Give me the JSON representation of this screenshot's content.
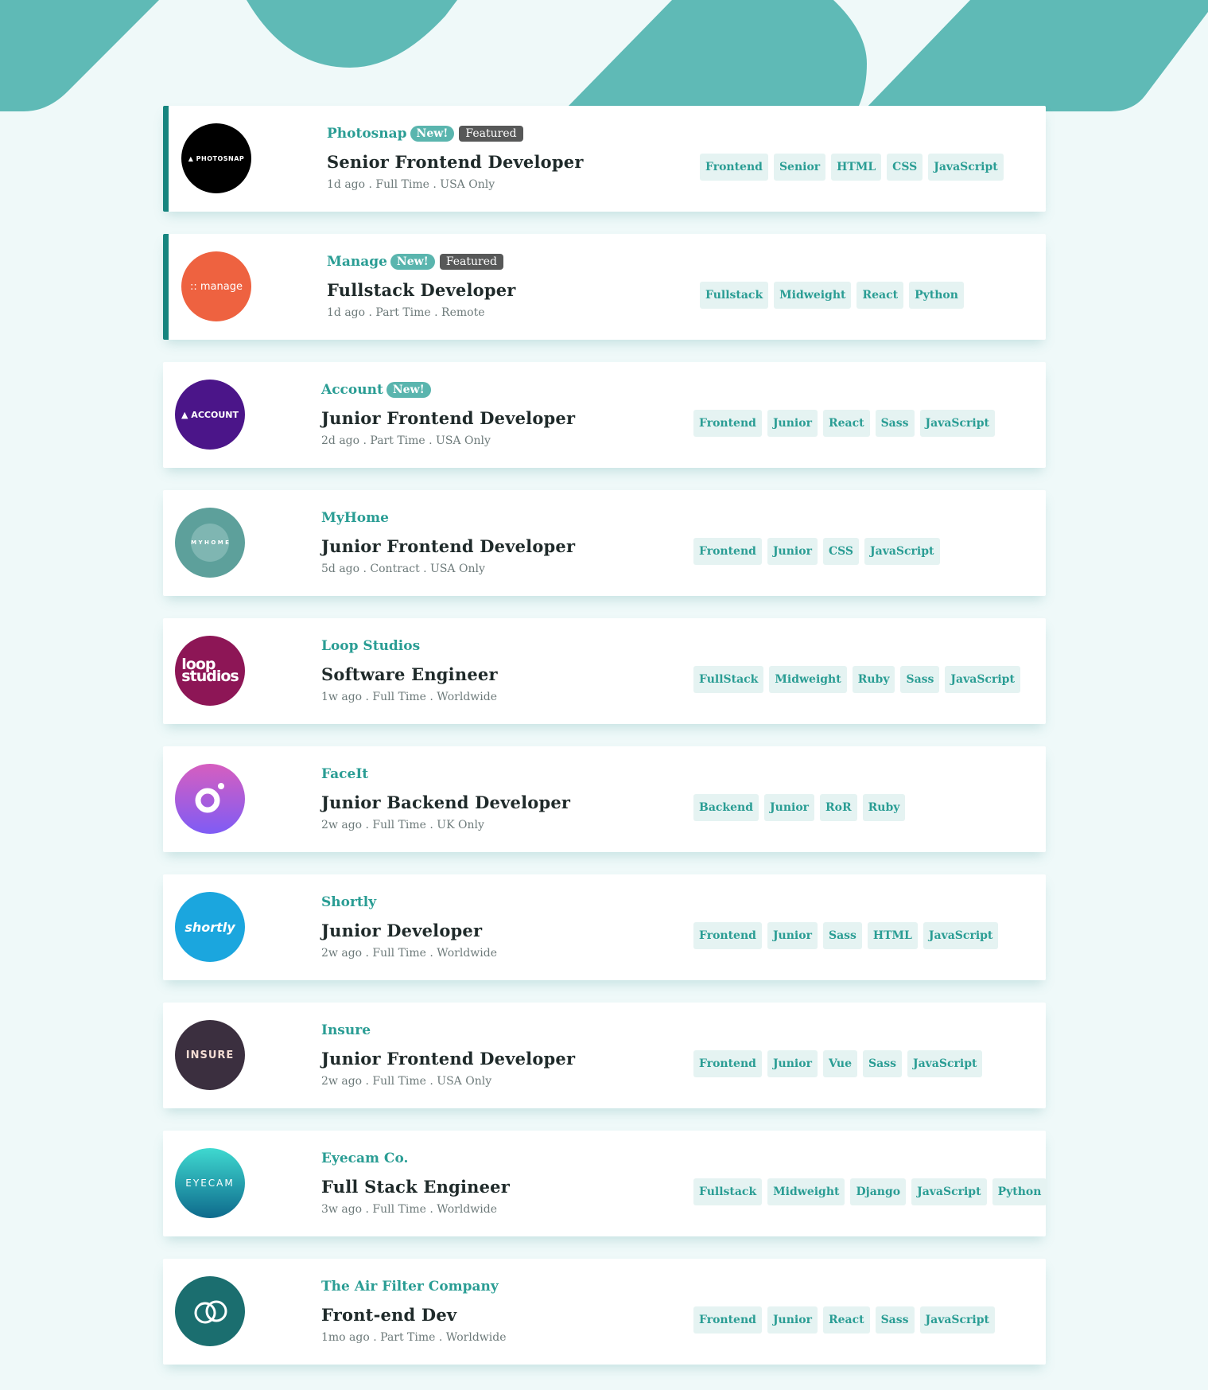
{
  "colors": {
    "primary": "#5ab5ae",
    "dark_cyan": "#16857f",
    "background": "#eff9f9",
    "tag_bg": "#e5f3f2"
  },
  "jobs": [
    {
      "company": "Photosnap",
      "new": "New!",
      "featured": "Featured",
      "position": "Senior Frontend Developer",
      "meta": "1d ago . Full Time . USA Only",
      "logo_text": "PHOTOSNAP",
      "logo_color": "#000000",
      "tags": [
        "Frontend",
        "Senior",
        "HTML",
        "CSS",
        "JavaScript"
      ]
    },
    {
      "company": "Manage",
      "new": "New!",
      "featured": "Featured",
      "position": "Fullstack Developer",
      "meta": "1d ago . Part Time . Remote",
      "logo_text": ":: manage",
      "logo_color": "#ee6240",
      "tags": [
        "Fullstack",
        "Midweight",
        "React",
        "Python"
      ]
    },
    {
      "company": "Account",
      "new": "New!",
      "position": "Junior Frontend Developer",
      "meta": "2d ago . Part Time . USA Only",
      "logo_text": "ACCOUNT",
      "logo_color": "#4b1589",
      "tags": [
        "Frontend",
        "Junior",
        "React",
        "Sass",
        "JavaScript"
      ]
    },
    {
      "company": "MyHome",
      "position": "Junior Frontend Developer",
      "meta": "5d ago . Contract . USA Only",
      "logo_text": "M Y H O M E",
      "logo_color": "#5da09b",
      "tags": [
        "Frontend",
        "Junior",
        "CSS",
        "JavaScript"
      ]
    },
    {
      "company": "Loop Studios",
      "position": "Software Engineer",
      "meta": "1w ago . Full Time . Worldwide",
      "logo_text": "loop studios",
      "logo_color": "#8d1656",
      "tags": [
        "FullStack",
        "Midweight",
        "Ruby",
        "Sass",
        "JavaScript"
      ]
    },
    {
      "company": "FaceIt",
      "position": "Junior Backend Developer",
      "meta": "2w ago . Full Time . UK Only",
      "logo_text": "",
      "logo_color": "#9b5ce5",
      "tags": [
        "Backend",
        "Junior",
        "RoR",
        "Ruby"
      ]
    },
    {
      "company": "Shortly",
      "position": "Junior Developer",
      "meta": "2w ago . Full Time . Worldwide",
      "logo_text": "shortly",
      "logo_color": "#1ba6de",
      "tags": [
        "Frontend",
        "Junior",
        "Sass",
        "HTML",
        "JavaScript"
      ]
    },
    {
      "company": "Insure",
      "position": "Junior Frontend Developer",
      "meta": "2w ago . Full Time . USA Only",
      "logo_text": "INSURE",
      "logo_color": "#3b2f3f",
      "tags": [
        "Frontend",
        "Junior",
        "Vue",
        "Sass",
        "JavaScript"
      ]
    },
    {
      "company": "Eyecam Co.",
      "position": "Full Stack Engineer",
      "meta": "3w ago . Full Time . Worldwide",
      "logo_text": "EYECAM",
      "logo_color": "#1e90a3",
      "tags": [
        "Fullstack",
        "Midweight",
        "Django",
        "JavaScript",
        "Python"
      ]
    },
    {
      "company": "The Air Filter Company",
      "position": "Front-end Dev",
      "meta": "1mo ago . Part Time . Worldwide",
      "logo_text": "",
      "logo_color": "#1b6e6f",
      "tags": [
        "Frontend",
        "Junior",
        "React",
        "Sass",
        "JavaScript"
      ]
    }
  ]
}
